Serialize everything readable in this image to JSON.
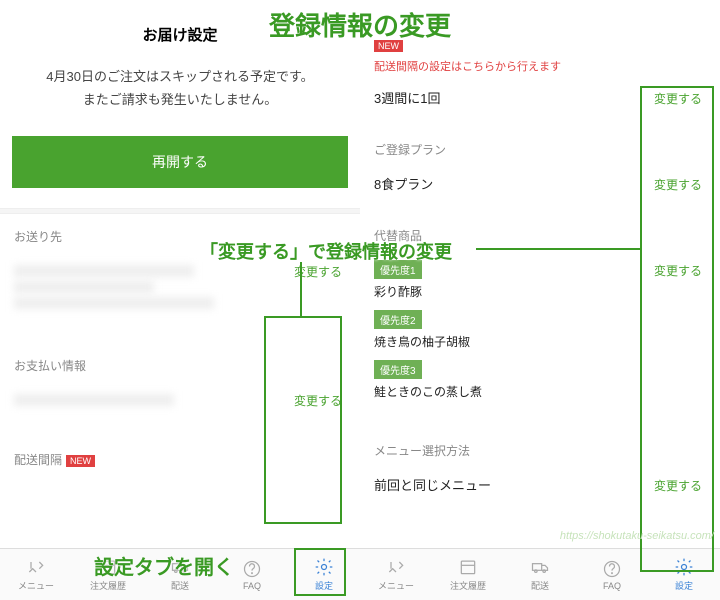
{
  "annotations": {
    "title": "登録情報の変更",
    "change_label": "「変更する」で登録情報の変更",
    "open_settings": "設定タブを開く"
  },
  "left": {
    "header": "お届け設定",
    "skip_msg_1": "4月30日のご注文はスキップされる予定です。",
    "skip_msg_2": "またご請求も発生いたしません。",
    "resume": "再開する",
    "addr_title": "お送り先",
    "change": "変更する",
    "pay_title": "お支払い情報",
    "interval_title": "配送間隔",
    "new": "NEW"
  },
  "right": {
    "note": "配送間隔の設定はこちらから行えます",
    "interval_val": "3週間に1回",
    "change": "変更する",
    "plan_title": "ご登録プラン",
    "plan_val": "8食プラン",
    "sub_title": "代替商品",
    "prio1": "優先度1",
    "dish1": "彩り酢豚",
    "prio2": "優先度2",
    "dish2": "焼き鳥の柚子胡椒",
    "prio3": "優先度3",
    "dish3": "鮭ときのこの蒸し煮",
    "menu_title": "メニュー選択方法",
    "menu_val": "前回と同じメニュー"
  },
  "tabs": {
    "menu": "メニュー",
    "order": "注文履歴",
    "ship": "配送",
    "faq": "FAQ",
    "settings": "設定"
  },
  "watermark": "https://shokutaku-seikatsu.com/"
}
